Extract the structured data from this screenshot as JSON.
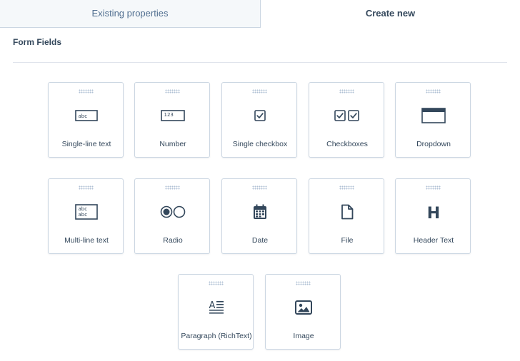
{
  "tabs": {
    "existing": "Existing properties",
    "create": "Create new"
  },
  "section": {
    "title": "Form Fields"
  },
  "fields": [
    {
      "label": "Single-line text",
      "icon": "single-line-text-icon",
      "icon_text": "abc"
    },
    {
      "label": "Number",
      "icon": "number-icon",
      "icon_text": "123"
    },
    {
      "label": "Single checkbox",
      "icon": "checkbox-icon"
    },
    {
      "label": "Checkboxes",
      "icon": "checkboxes-icon"
    },
    {
      "label": "Dropdown",
      "icon": "dropdown-icon"
    },
    {
      "label": "Multi-line text",
      "icon": "multi-line-text-icon",
      "icon_text_1": "abc",
      "icon_text_2": "abc"
    },
    {
      "label": "Radio",
      "icon": "radio-icon"
    },
    {
      "label": "Date",
      "icon": "calendar-icon"
    },
    {
      "label": "File",
      "icon": "file-icon"
    },
    {
      "label": "Header Text",
      "icon": "header-icon",
      "icon_text": "H"
    },
    {
      "label": "Paragraph (RichText)",
      "icon": "paragraph-icon",
      "icon_text": "A"
    },
    {
      "label": "Image",
      "icon": "image-icon"
    }
  ],
  "colors": {
    "text": "#33475b",
    "icon": "#33475b",
    "border": "#cbd6e2"
  }
}
